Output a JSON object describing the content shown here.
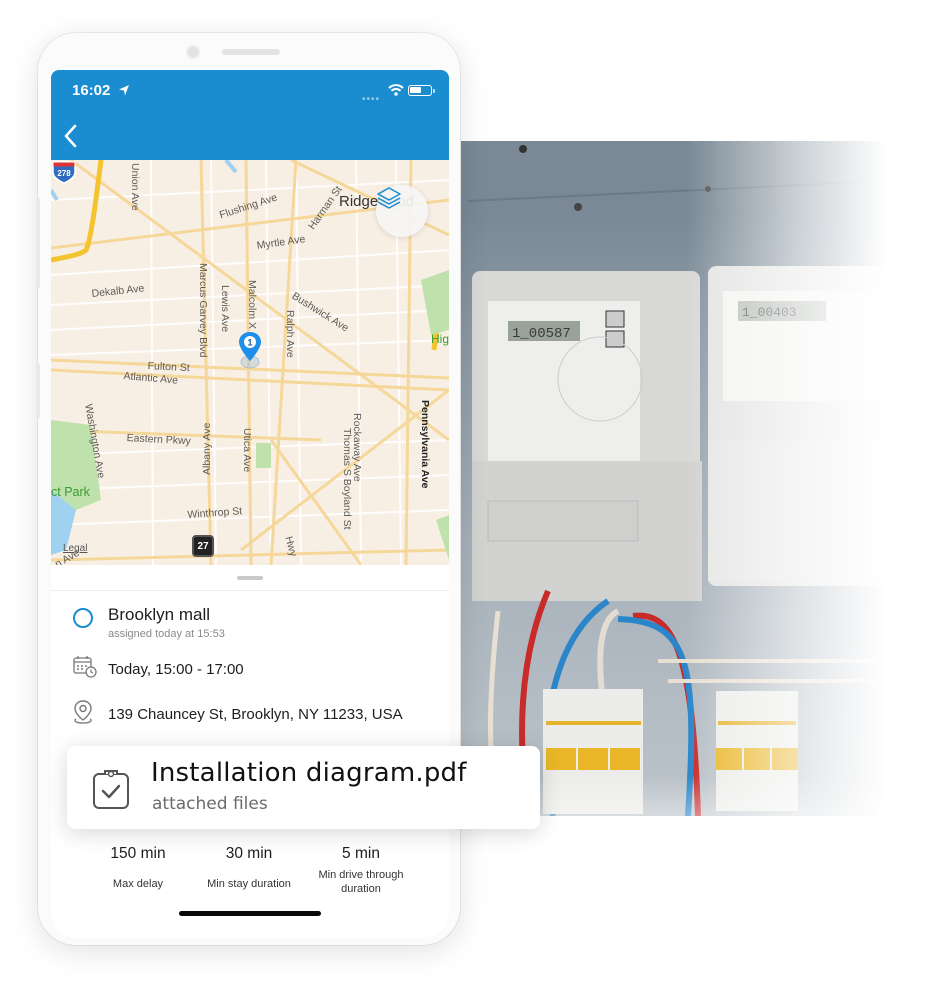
{
  "status_bar": {
    "time": "16:02"
  },
  "nav": {
    "back_label": "Back"
  },
  "map": {
    "labels": {
      "union": "Union Ave",
      "flushing": "Flushing Ave",
      "harman": "Harman St",
      "ridgewood": "Ridgewood",
      "myrtle": "Myrtle Ave",
      "dekalb": "Dekalb Ave",
      "marcus": "Marcus Garvey Blvd",
      "lewis": "Lewis Ave",
      "malcolm": "Malcolm X",
      "ralph": "Ralph Ave",
      "bushwick": "Bushwick Ave",
      "high": "Hig",
      "fulton": "Fulton St",
      "atlantic": "Atlantic Ave",
      "washington": "Washington Ave",
      "eastern": "Eastern Pkwy",
      "albany": "Albany Ave",
      "utica": "Utica Ave",
      "rockaway": "Rockaway Ave",
      "thomas": "Thomas S Boyland St",
      "pennsylvania": "Pennsylvania Ave",
      "park": "ct Park",
      "winthrop": "Winthrop St",
      "hwy": "Hwy",
      "legal": "Legal",
      "nave": "n Ave"
    },
    "shield_278": "278",
    "shield_27": "27",
    "pin_number": "1"
  },
  "job": {
    "title": "Brooklyn mall",
    "assigned": "assigned today at 15:53",
    "time_window": "Today, 15:00 - 17:00",
    "address": "139 Chauncey St, Brooklyn, NY 11233, USA"
  },
  "attachment": {
    "file_name": "Installation diagram.pdf",
    "subtitle": "attached files"
  },
  "stats": [
    {
      "value": "150 min",
      "label": "Max delay"
    },
    {
      "value": "30 min",
      "label": "Min stay duration"
    },
    {
      "value": "5 min",
      "label": "Min drive through duration"
    }
  ],
  "colors": {
    "brand": "#1a8dd0"
  }
}
